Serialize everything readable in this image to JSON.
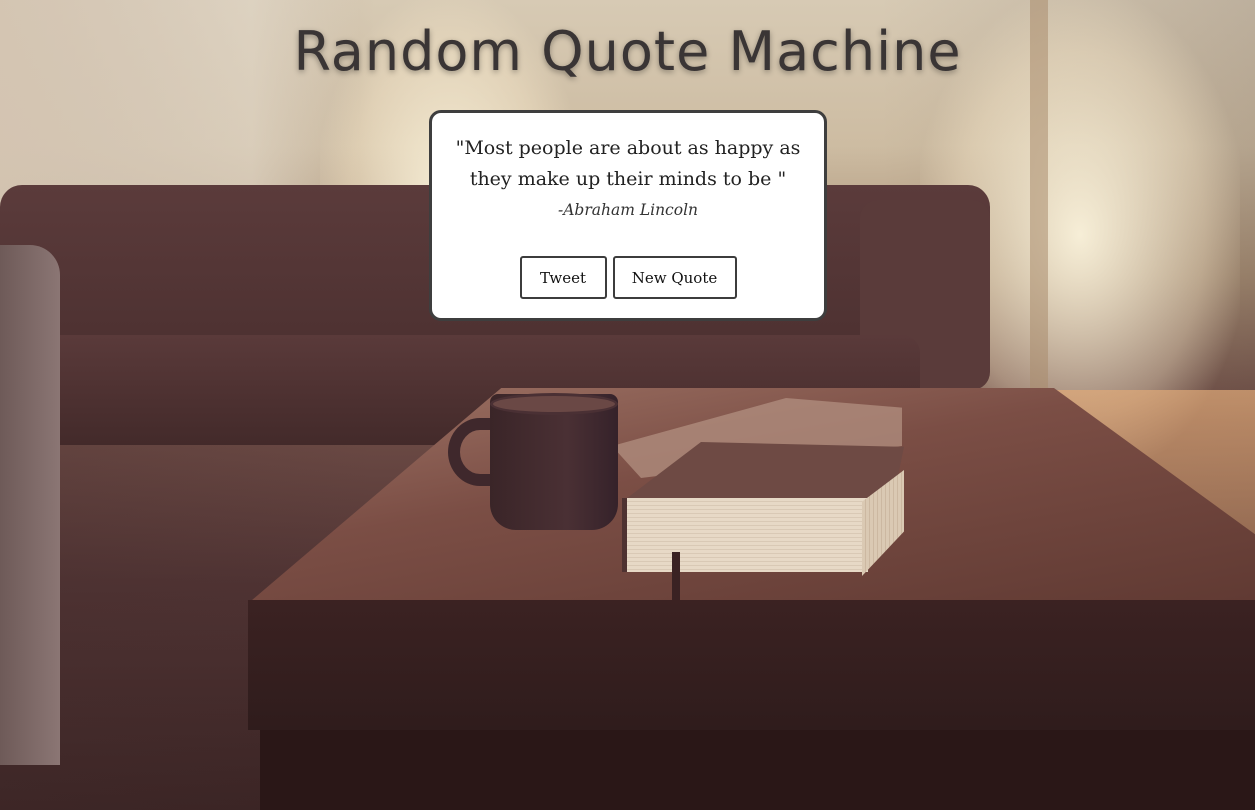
{
  "page": {
    "title": "Random Quote Machine"
  },
  "quote": {
    "text": "\"Most people are about as happy as they make up their minds to be \"",
    "author": "-Abraham Lincoln"
  },
  "buttons": {
    "tweet_label": "Tweet",
    "new_quote_label": "New Quote"
  },
  "colors": {
    "title_text": "#3a3535",
    "card_background": "#ffffff",
    "card_border": "#3e3e3e",
    "button_border": "#3c3c3c"
  }
}
